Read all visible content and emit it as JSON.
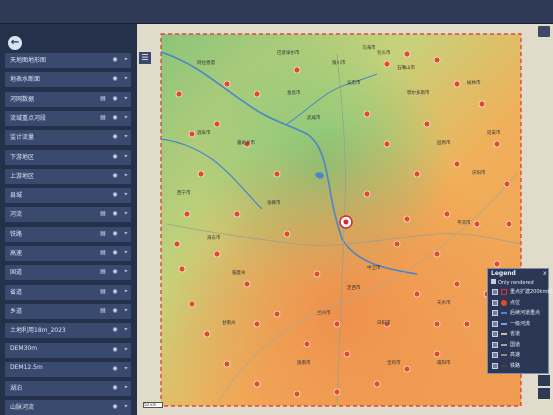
{
  "sidebar": {
    "layers": [
      {
        "label": "天地图地形图",
        "table": false
      },
      {
        "label": "地表水断面",
        "table": false
      },
      {
        "label": "河网数据",
        "table": true
      },
      {
        "label": "流域重点河段",
        "table": true
      },
      {
        "label": "监计流量",
        "table": false
      },
      {
        "label": "下游地区",
        "table": false
      },
      {
        "label": "上游地区",
        "table": false
      },
      {
        "label": "县城",
        "table": false
      },
      {
        "label": "河流",
        "table": true
      },
      {
        "label": "铁路",
        "table": true
      },
      {
        "label": "高速",
        "table": true
      },
      {
        "label": "国道",
        "table": true
      },
      {
        "label": "省道",
        "table": true
      },
      {
        "label": "乡道",
        "table": true
      },
      {
        "label": "土地利用18m_2023",
        "table": false
      },
      {
        "label": "DEM30m",
        "table": false
      },
      {
        "label": "DEM12.5m",
        "table": false
      },
      {
        "label": "湖泊",
        "table": false
      },
      {
        "label": "山脉河流",
        "table": false
      }
    ]
  },
  "legend": {
    "title": "Legend",
    "close": "x",
    "only_rendered": "Only rendered",
    "items": [
      {
        "label": "重点扩建200km缓冲",
        "symbol": "dash-red"
      },
      {
        "label": "点位",
        "symbol": "dot-red"
      },
      {
        "label": "后续河道重点",
        "symbol": "line-blue"
      },
      {
        "label": "一级河流",
        "symbol": "line-blue2"
      },
      {
        "label": "省道",
        "symbol": "line-gray"
      },
      {
        "label": "国道",
        "symbol": "line-gray2"
      },
      {
        "label": "高速",
        "symbol": "line-gray3"
      },
      {
        "label": "铁路",
        "symbol": "line-dark"
      }
    ]
  },
  "map": {
    "place_labels": [
      "嘉峪关市",
      "酒泉市",
      "张掖市",
      "武威市",
      "金昌市",
      "银川市",
      "中卫市",
      "白银市",
      "兰州市",
      "定西市",
      "天水市",
      "平凉市",
      "庆阳市",
      "固原市",
      "临夏州",
      "甘南州",
      "陇南市",
      "西宁市",
      "海东市",
      "延安市",
      "榆林市",
      "鄂尔多斯市",
      "包头市",
      "巴彦淖尔市",
      "阿拉善盟",
      "吴忠市",
      "石嘴山市",
      "乌海市",
      "宝鸡市",
      "咸阳市"
    ],
    "scale_label": "50 km"
  },
  "colors": {
    "buffer": "#e03030",
    "marker": "#e24a2a",
    "river": "#4a86c8",
    "sidebar": "#25304a",
    "topbar": "#2e3a55"
  }
}
